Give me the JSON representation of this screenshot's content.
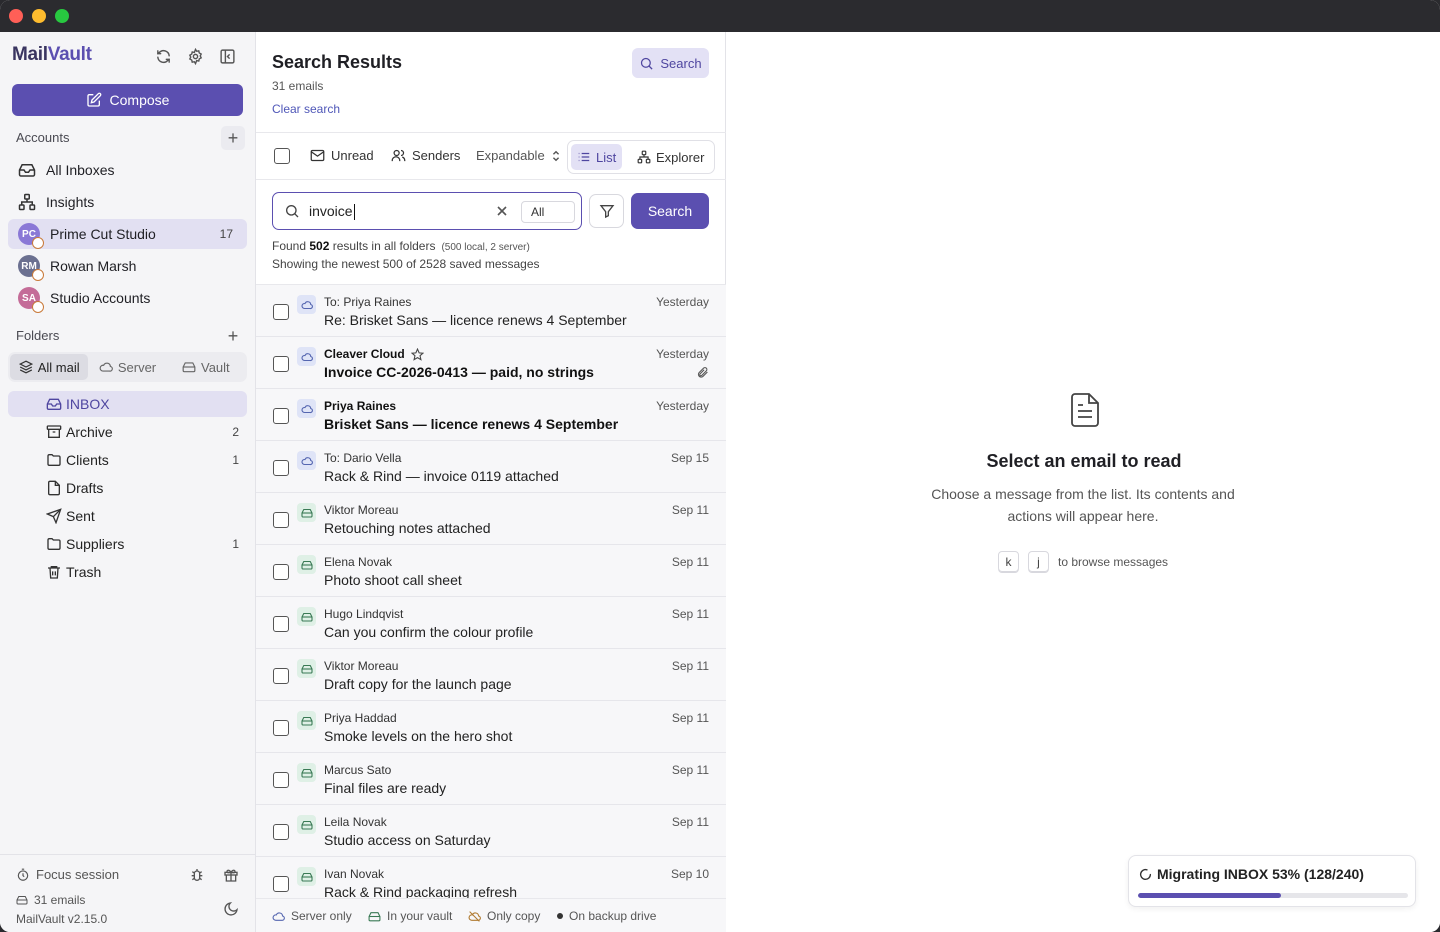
{
  "app": {
    "logo_a": "Mail",
    "logo_b": "Vault"
  },
  "sidebar": {
    "compose_label": "Compose",
    "accounts_label": "Accounts",
    "nav": [
      {
        "label": "All Inboxes"
      },
      {
        "label": "Insights"
      }
    ],
    "accounts": [
      {
        "initials": "PC",
        "label": "Prime Cut Studio",
        "count": "17",
        "color": "#8a78d6"
      },
      {
        "initials": "RM",
        "label": "Rowan Marsh",
        "count": "",
        "color": "#6b7090"
      },
      {
        "initials": "SA",
        "label": "Studio Accounts",
        "count": "",
        "color": "#c46c98"
      }
    ],
    "folders_label": "Folders",
    "segments": [
      "All mail",
      "Server",
      "Vault"
    ],
    "folders": [
      {
        "label": "INBOX",
        "count": "",
        "icon": "inbox-icon"
      },
      {
        "label": "Archive",
        "count": "2",
        "icon": "archive-icon"
      },
      {
        "label": "Clients",
        "count": "1",
        "icon": "folder-icon"
      },
      {
        "label": "Drafts",
        "count": "",
        "icon": "draft-icon"
      },
      {
        "label": "Sent",
        "count": "",
        "icon": "send-icon"
      },
      {
        "label": "Suppliers",
        "count": "1",
        "icon": "folder-icon"
      },
      {
        "label": "Trash",
        "count": "",
        "icon": "trash-icon"
      }
    ],
    "footer": {
      "focus_label": "Focus session",
      "emails_label": "31 emails",
      "version": "MailVault v2.15.0"
    }
  },
  "list": {
    "title": "Search Results",
    "subtitle": "31 emails",
    "clear_label": "Clear search",
    "search_top_label": "Search",
    "toolbar": {
      "unread": "Unread",
      "senders": "Senders",
      "expandable": "Expandable",
      "list": "List",
      "explorer": "Explorer"
    },
    "search": {
      "value": "invoice",
      "scope": "All",
      "button": "Search"
    },
    "found": {
      "prefix": "Found",
      "count": "502",
      "suffix": "results in all folders",
      "detail": "(500 local, 2 server)",
      "line2": "Showing the newest 500 of 2528 saved messages"
    },
    "messages": [
      {
        "from": "To: Priya Raines",
        "subject": "Re: Brisket Sans — licence renews 4 September",
        "date": "Yesterday",
        "src": "cloud",
        "unread": false,
        "star": false,
        "clip": false
      },
      {
        "from": "Cleaver Cloud",
        "subject": "Invoice CC-2026-0413 — paid, no strings",
        "date": "Yesterday",
        "src": "cloud",
        "unread": true,
        "star": true,
        "clip": true
      },
      {
        "from": "Priya Raines",
        "subject": "Brisket Sans — licence renews 4 September",
        "date": "Yesterday",
        "src": "cloud",
        "unread": true,
        "star": false,
        "clip": false
      },
      {
        "from": "To: Dario Vella",
        "subject": "Rack & Rind — invoice 0119 attached",
        "date": "Sep 15",
        "src": "cloud",
        "unread": false,
        "star": false,
        "clip": false
      },
      {
        "from": "Viktor Moreau",
        "subject": "Retouching notes attached",
        "date": "Sep 11",
        "src": "vault",
        "unread": false,
        "star": false,
        "clip": false
      },
      {
        "from": "Elena Novak",
        "subject": "Photo shoot call sheet",
        "date": "Sep 11",
        "src": "vault",
        "unread": false,
        "star": false,
        "clip": false
      },
      {
        "from": "Hugo Lindqvist",
        "subject": "Can you confirm the colour profile",
        "date": "Sep 11",
        "src": "vault",
        "unread": false,
        "star": false,
        "clip": false
      },
      {
        "from": "Viktor Moreau",
        "subject": "Draft copy for the launch page",
        "date": "Sep 11",
        "src": "vault",
        "unread": false,
        "star": false,
        "clip": false
      },
      {
        "from": "Priya Haddad",
        "subject": "Smoke levels on the hero shot",
        "date": "Sep 11",
        "src": "vault",
        "unread": false,
        "star": false,
        "clip": false
      },
      {
        "from": "Marcus Sato",
        "subject": "Final files are ready",
        "date": "Sep 11",
        "src": "vault",
        "unread": false,
        "star": false,
        "clip": false
      },
      {
        "from": "Leila Novak",
        "subject": "Studio access on Saturday",
        "date": "Sep 11",
        "src": "vault",
        "unread": false,
        "star": false,
        "clip": false
      },
      {
        "from": "Ivan Novak",
        "subject": "Rack & Rind packaging refresh",
        "date": "Sep 10",
        "src": "vault",
        "unread": false,
        "star": false,
        "clip": false
      }
    ],
    "legend": {
      "server_only": "Server only",
      "in_vault": "In your vault",
      "only_copy": "Only copy",
      "backup": "On backup drive"
    }
  },
  "reading": {
    "title": "Select an email to read",
    "desc": "Choose a message from the list. Its contents and actions will appear here.",
    "key1": "k",
    "key2": "j",
    "keys_hint": "to browse messages"
  },
  "migration": {
    "label": "Migrating INBOX 53% (128/240)",
    "progress": 0.53
  },
  "colors": {
    "accent": "#5b4fb0",
    "accent_soft": "#e3e1f5"
  }
}
